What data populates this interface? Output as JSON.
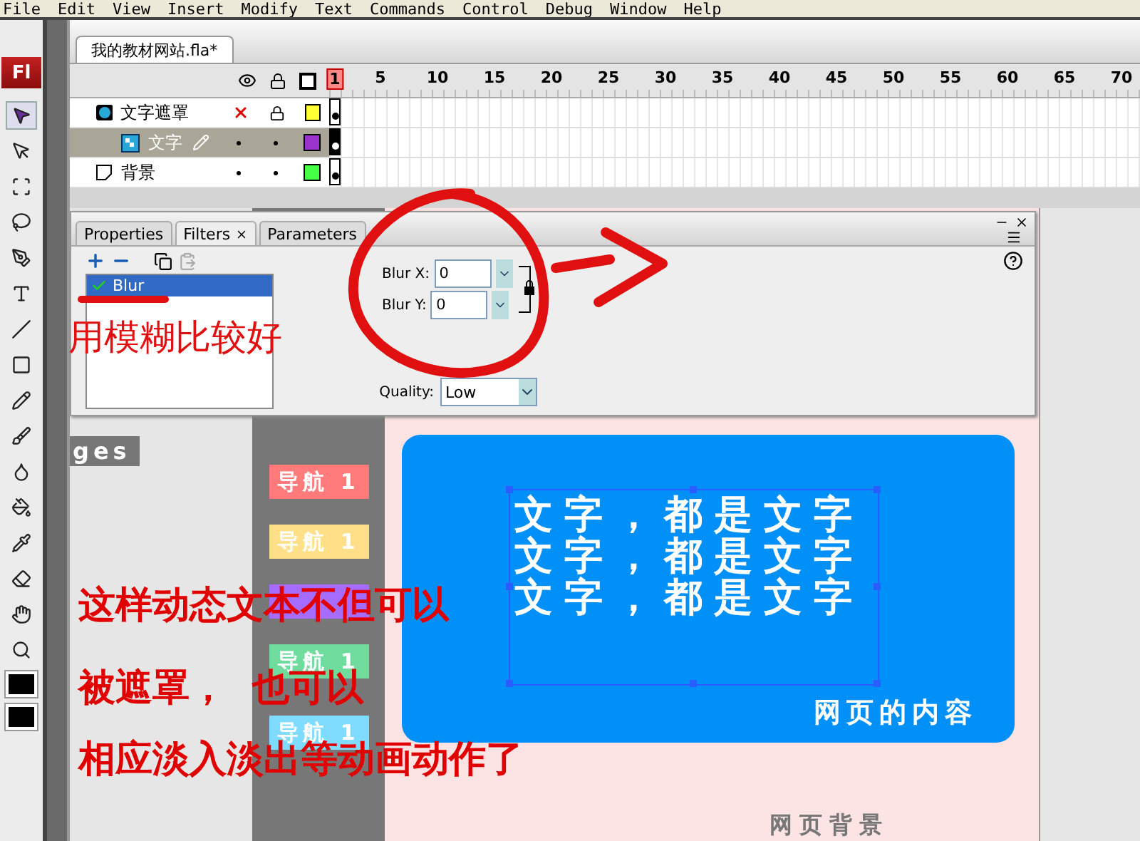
{
  "menu": [
    "File",
    "Edit",
    "View",
    "Insert",
    "Modify",
    "Text",
    "Commands",
    "Control",
    "Debug",
    "Window",
    "Help"
  ],
  "logo": "Fl",
  "document_tab": {
    "label": "我的教材网站.fla*",
    "selected": true
  },
  "timeline": {
    "frame_numbers": [
      "1",
      "5",
      "10",
      "15",
      "20",
      "25",
      "30",
      "35",
      "40",
      "45",
      "50",
      "55",
      "60",
      "65",
      "70"
    ],
    "layers": [
      {
        "name": "文字遮罩",
        "kind": "mask",
        "hidden": true,
        "locked": true,
        "selected": false,
        "color": "#ffff33"
      },
      {
        "name": "文字",
        "kind": "masked",
        "hidden": false,
        "locked": false,
        "selected": true,
        "color": "#9933cc"
      },
      {
        "name": "背景",
        "kind": "normal",
        "hidden": false,
        "locked": false,
        "selected": false,
        "color": "#44ff44"
      }
    ]
  },
  "filters_panel": {
    "tabs": [
      {
        "label": "Properties",
        "selected": false
      },
      {
        "label": "Filters",
        "selected": true
      },
      {
        "label": "Parameters",
        "selected": false
      }
    ],
    "filters": [
      {
        "label": "Blur",
        "enabled": true,
        "selected": true
      }
    ],
    "fields": [
      {
        "label": "Blur X:",
        "value": "0"
      },
      {
        "label": "Blur Y:",
        "value": "0"
      }
    ],
    "quality": {
      "label": "Quality:",
      "value": "Low"
    }
  },
  "stage": {
    "side_label": "ges",
    "nav_buttons": [
      {
        "label": "导航 1",
        "color": "#ff7b7b"
      },
      {
        "label": "导航 1",
        "color": "#ffdf88"
      },
      {
        "color": "#a56cff"
      },
      {
        "label": "导航 1",
        "color": "#6fdb9c"
      },
      {
        "label": "导航 1",
        "color": "#7fdcff"
      }
    ],
    "content_lines": [
      "文字，都是文字",
      "文字，都是文字",
      "文字，都是文字"
    ],
    "content_caption": "网页的内容",
    "background_label": "网页背景"
  },
  "annotations": {
    "note": "用模糊比较好",
    "callout": [
      "这样动态文本不但可以",
      "被遮罩，  也可以",
      "相应淡入淡出等动画动作了"
    ]
  }
}
